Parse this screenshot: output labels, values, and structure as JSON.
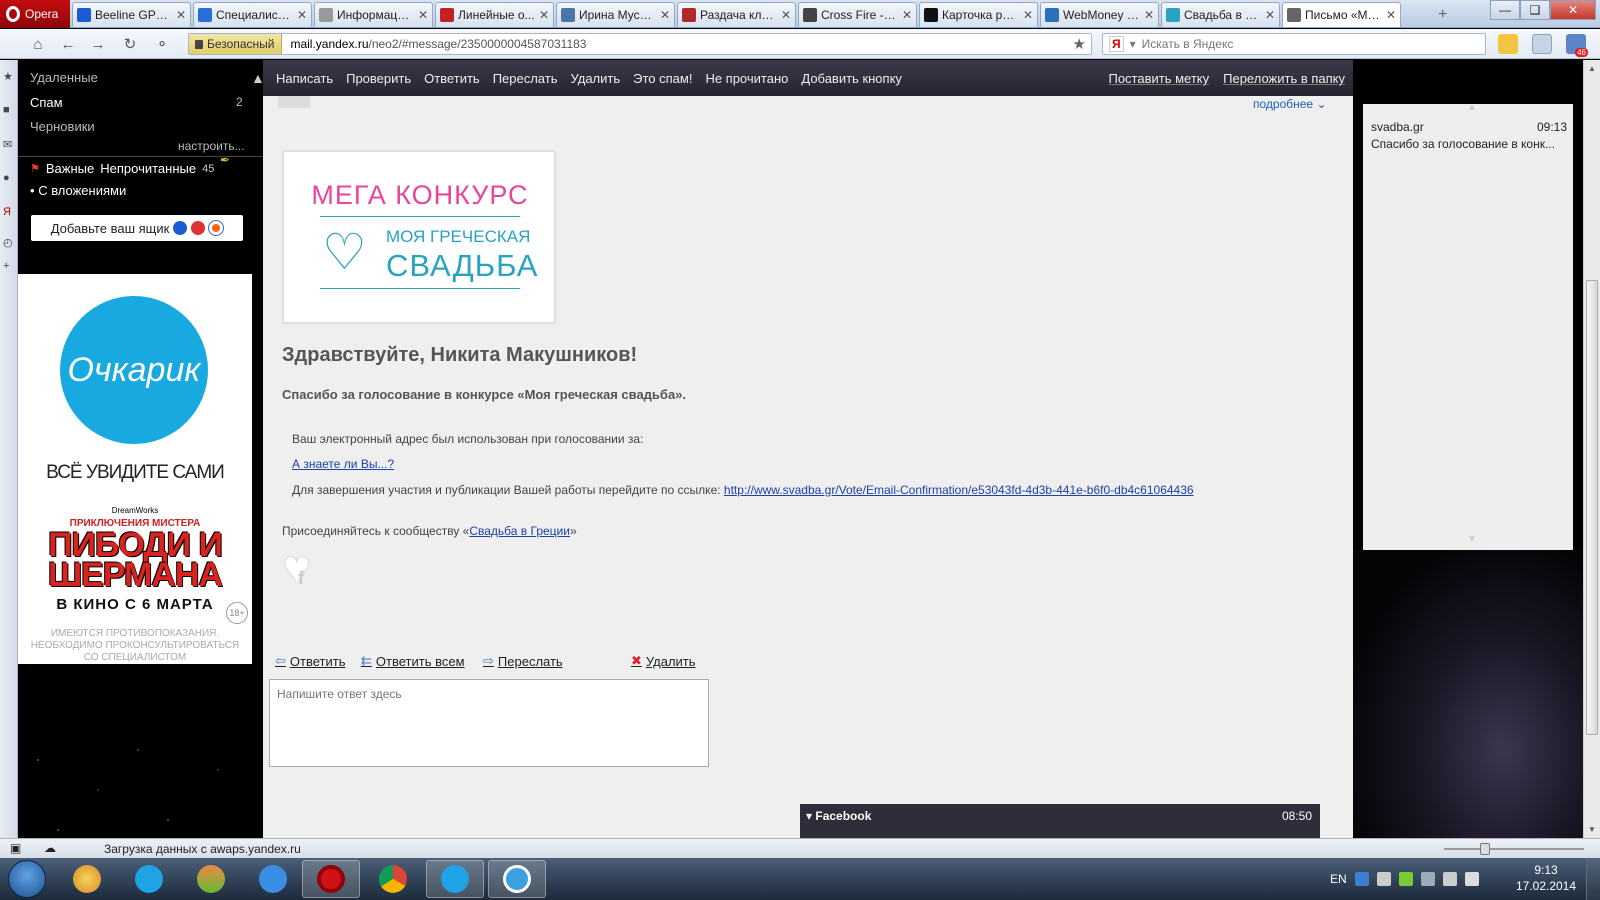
{
  "browser": {
    "menu_label": "Opera",
    "tabs": [
      {
        "title": "Beeline GPRS...",
        "color": "#1a5bd6"
      },
      {
        "title": "Специалист ...",
        "color": "#2a6fd8"
      },
      {
        "title": "Информаци...",
        "color": "#999999"
      },
      {
        "title": "Линейные о...",
        "color": "#c22222"
      },
      {
        "title": "Ирина Муста...",
        "color": "#4a76a8"
      },
      {
        "title": "Раздача клю...",
        "color": "#b02a2a"
      },
      {
        "title": "Cross Fire - б...",
        "color": "#444444"
      },
      {
        "title": "Карточка ра...",
        "color": "#111111"
      },
      {
        "title": "WebMoney К...",
        "color": "#2d6fbf"
      },
      {
        "title": "Свадьба в Гр...",
        "color": "#2aa3c0"
      },
      {
        "title": "Письмо «Му...",
        "color": "#666666",
        "active": true
      }
    ],
    "secure_label": "Безопасный",
    "url_host": "mail.yandex.ru",
    "url_path": "/neo2/#message/2350000004587031183",
    "search_engine": "Я",
    "search_placeholder": "Искать в Яндекс",
    "mail_badge": "46",
    "status_text": "Загрузка данных с awaps.yandex.ru"
  },
  "sidebar": {
    "folders": [
      {
        "label": "Удаленные"
      },
      {
        "label": "Спам",
        "count": "2"
      },
      {
        "label": "Черновики"
      }
    ],
    "setup_label": "настроить...",
    "labels": {
      "important": "Важные",
      "unread": "Непрочитанные",
      "unread_count": "45"
    },
    "attachments_label": "С вложениями",
    "add_mailbox_label": "Добавьте ваш ящик"
  },
  "ad": {
    "brand": "Очкарик",
    "slogan": "ВСЁ УВИДИТЕ САМИ",
    "studio": "DreamWorks",
    "movie_sub": "ПРИКЛЮЧЕНИЯ МИСТЕРА",
    "movie_title": "ПИБОДИ И ШЕРМАНА",
    "release": "В КИНО С 6 МАРТА",
    "age": "18+",
    "warning": "ИМЕЮТСЯ ПРОТИВОПОКАЗАНИЯ. НЕОБХОДИМО ПРОКОНСУЛЬТИРОВАТЬСЯ СО СПЕЦИАЛИСТОМ"
  },
  "toolbar": {
    "actions": [
      "Написать",
      "Проверить",
      "Ответить",
      "Переслать",
      "Удалить",
      "Это спам!",
      "Не прочитано",
      "Добавить кнопку"
    ],
    "right_actions": [
      "Поставить метку",
      "Переложить в папку"
    ]
  },
  "message": {
    "more_link": "подробнее",
    "banner": {
      "line1": "МЕГА КОНКУРС",
      "line2": "МОЯ ГРЕЧЕСКАЯ",
      "line3": "СВАДЬБА"
    },
    "greeting": "Здравствуйте, Никита Макушников!",
    "thanks": "Спасибо за голосование в конкурсе «Моя греческая свадьба».",
    "used_for": "Ваш электронный адрес был использован при голосовании за:",
    "did_you_know": "А знаете ли Вы...?",
    "confirm_text": "Для завершения участия и публикации Вашей работы перейдите по ссылке:",
    "confirm_url": "http://www.svadba.gr/Vote/Email-Confirmation/e53043fd-4d3b-441e-b6f0-db4c61064436",
    "community_prefix": "Присоединяйтесь к сообществу «",
    "community_link": "Свадьба в Греции",
    "community_suffix": "»",
    "reply_actions": {
      "reply": "Ответить",
      "reply_all": "Ответить всем",
      "forward": "Переслать",
      "delete": "Удалить"
    },
    "reply_placeholder": "Напишите ответ здесь"
  },
  "notification": {
    "title": "Facebook",
    "time": "08:50"
  },
  "thread": {
    "from": "svadba.gr",
    "time": "09:13",
    "subject": "Спасибо за голосование в конк..."
  },
  "taskbar": {
    "lang": "EN",
    "time": "9:13",
    "date": "17.02.2014"
  }
}
